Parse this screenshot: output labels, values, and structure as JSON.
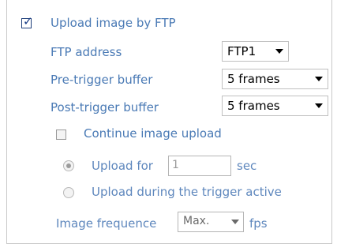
{
  "ftp_upload": {
    "enable_label": "Upload image by FTP",
    "enable_checked": true,
    "ftp_address_label": "FTP address",
    "ftp_address_value": "FTP1",
    "pre_trigger_label": "Pre-trigger buffer",
    "pre_trigger_value": "5  frames",
    "post_trigger_label": "Post-trigger buffer",
    "post_trigger_value": "5  frames",
    "continue_label": "Continue image upload",
    "continue_checked": false,
    "upload_for_label": "Upload for",
    "upload_for_value": "1",
    "upload_for_unit": "sec",
    "upload_during_label": "Upload during the trigger active",
    "frequency_label": "Image frequence",
    "frequency_value": "Max.",
    "frequency_unit": "fps"
  },
  "colors": {
    "label": "#4a7ab5",
    "check": "#1c3f88"
  },
  "icons": {
    "checkmark": "checkmark-icon",
    "dropdown": "chevron-down-icon"
  }
}
